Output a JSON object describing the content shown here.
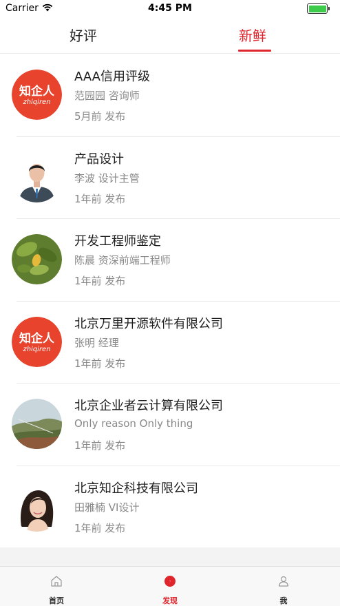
{
  "status_bar": {
    "carrier": "Carrier",
    "time": "4:45 PM"
  },
  "tabs": {
    "good": "好评",
    "new": "新鲜",
    "active": "new"
  },
  "items": [
    {
      "title": "AAA信用评级",
      "subtitle": "范园园  咨询师",
      "time": "5月前  发布",
      "avatar": "zhiqiren-logo",
      "logo_text": "知企人",
      "logo_sub": "zhiqiren"
    },
    {
      "title": "产品设计",
      "subtitle": "李波  设计主管",
      "time": "1年前  发布",
      "avatar": "businessman-photo"
    },
    {
      "title": "开发工程师鉴定",
      "subtitle": "陈晨  资深前端工程师",
      "time": "1年前  发布",
      "avatar": "leaf-photo"
    },
    {
      "title": "北京万里开源软件有限公司",
      "subtitle": "张明  经理",
      "time": "1年前  发布",
      "avatar": "zhiqiren-logo",
      "logo_text": "知企人",
      "logo_sub": "zhiqiren"
    },
    {
      "title": "北京企业者云计算有限公司",
      "subtitle": "Only reason  Only thing",
      "time": "1年前  发布",
      "avatar": "landscape-photo"
    },
    {
      "title": "北京知企科技有限公司",
      "subtitle": "田雅楠  VI设计",
      "time": "1年前  发布",
      "avatar": "woman-photo"
    }
  ],
  "tabbar": {
    "home": "首页",
    "discover": "发现",
    "me": "我",
    "active": "discover"
  },
  "colors": {
    "accent": "#e0242b",
    "logo_red": "#e8432c",
    "battery": "#3ccb4a"
  }
}
